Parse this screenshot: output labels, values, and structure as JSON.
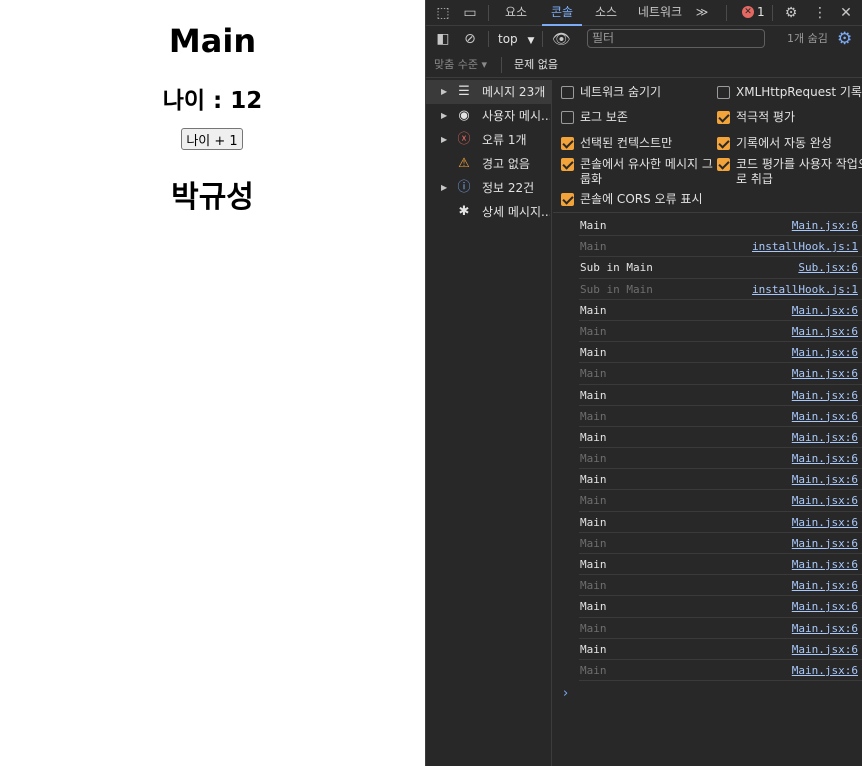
{
  "app": {
    "title": "Main",
    "age_text": "나이 : 12",
    "increment_button": "나이 + 1",
    "name": "박규성"
  },
  "devtools": {
    "tabs": [
      "요소",
      "콘솔",
      "소스",
      "네트워크"
    ],
    "active_tab": "콘솔",
    "more_tabs": "≫",
    "error_badge": "✕",
    "error_count": "1",
    "context": "top",
    "filter_placeholder": "필터",
    "hidden_count": "1개 숨김",
    "log_levels": "맞춤 수준 ▾",
    "issues": "문제 없음",
    "sidebar": [
      {
        "label": "메시지 23개",
        "icon": "list-icon",
        "glyph": "☰",
        "color": "#e3e3e3",
        "caret": true,
        "active": true
      },
      {
        "label": "사용자 메시...",
        "icon": "user-icon",
        "glyph": "◉",
        "color": "#e3e3e3",
        "caret": true,
        "active": false
      },
      {
        "label": "오류 1개",
        "icon": "error-icon",
        "glyph": "ⓧ",
        "color": "#e46962",
        "caret": true,
        "active": false
      },
      {
        "label": "경고 없음",
        "icon": "warning-icon",
        "glyph": "⚠",
        "color": "#f2a33a",
        "caret": false,
        "active": false
      },
      {
        "label": "정보 22건",
        "icon": "info-icon",
        "glyph": "ⓘ",
        "color": "#7cacf8",
        "caret": true,
        "active": false
      },
      {
        "label": "상세 메시지...",
        "icon": "bug-icon",
        "glyph": "✱",
        "color": "#e3e3e3",
        "caret": false,
        "active": false
      }
    ],
    "settings": {
      "left": [
        {
          "label": "네트워크 숨기기",
          "checked": false
        },
        {
          "label": "로그 보존",
          "checked": false
        },
        {
          "label": "선택된 컨텍스트만",
          "checked": true
        },
        {
          "label": "콘솔에서 유사한 메시지 그룹화",
          "checked": true
        },
        {
          "label": "콘솔에 CORS 오류 표시",
          "checked": true
        }
      ],
      "right": [
        {
          "label": "XMLHttpRequest 기록",
          "checked": false
        },
        {
          "label": "적극적 평가",
          "checked": true
        },
        {
          "label": "기록에서 자동 완성",
          "checked": true
        },
        {
          "label": "코드 평가를 사용자 작업으로 취급",
          "checked": true
        }
      ]
    },
    "messages": [
      {
        "text": "Main",
        "source": "Main.jsx:6",
        "dim": false
      },
      {
        "text": "Main",
        "source": "installHook.js:1",
        "dim": true
      },
      {
        "text": "Sub in Main",
        "source": "Sub.jsx:6",
        "dim": false
      },
      {
        "text": "Sub in Main",
        "source": "installHook.js:1",
        "dim": true
      },
      {
        "text": "Main",
        "source": "Main.jsx:6",
        "dim": false
      },
      {
        "text": "Main",
        "source": "Main.jsx:6",
        "dim": true
      },
      {
        "text": "Main",
        "source": "Main.jsx:6",
        "dim": false
      },
      {
        "text": "Main",
        "source": "Main.jsx:6",
        "dim": true
      },
      {
        "text": "Main",
        "source": "Main.jsx:6",
        "dim": false
      },
      {
        "text": "Main",
        "source": "Main.jsx:6",
        "dim": true
      },
      {
        "text": "Main",
        "source": "Main.jsx:6",
        "dim": false
      },
      {
        "text": "Main",
        "source": "Main.jsx:6",
        "dim": true
      },
      {
        "text": "Main",
        "source": "Main.jsx:6",
        "dim": false
      },
      {
        "text": "Main",
        "source": "Main.jsx:6",
        "dim": true
      },
      {
        "text": "Main",
        "source": "Main.jsx:6",
        "dim": false
      },
      {
        "text": "Main",
        "source": "Main.jsx:6",
        "dim": true
      },
      {
        "text": "Main",
        "source": "Main.jsx:6",
        "dim": false
      },
      {
        "text": "Main",
        "source": "Main.jsx:6",
        "dim": true
      },
      {
        "text": "Main",
        "source": "Main.jsx:6",
        "dim": false
      },
      {
        "text": "Main",
        "source": "Main.jsx:6",
        "dim": true
      },
      {
        "text": "Main",
        "source": "Main.jsx:6",
        "dim": false
      },
      {
        "text": "Main",
        "source": "Main.jsx:6",
        "dim": true
      }
    ],
    "prompt": "›"
  }
}
